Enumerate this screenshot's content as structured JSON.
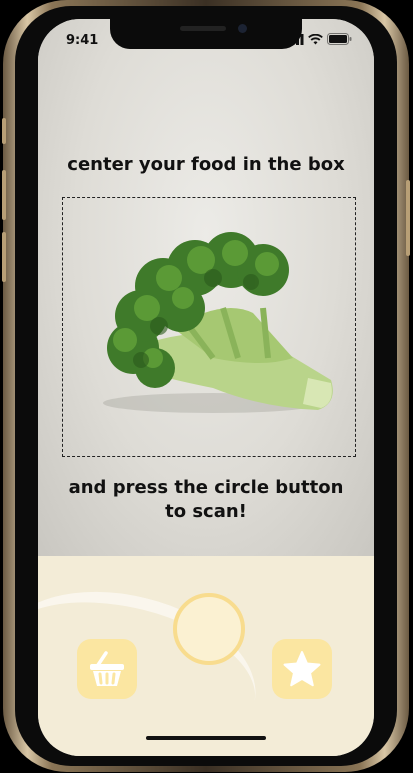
{
  "status_bar": {
    "time": "9:41"
  },
  "instructions": {
    "top": "center your food in the box",
    "bottom_line1": "and press the circle button",
    "bottom_line2": "to scan!"
  },
  "icons": {
    "basket": "basket-icon",
    "star": "star-icon",
    "broccoli": "broccoli-image"
  },
  "colors": {
    "panel": "#f3ecd7",
    "button_fill": "#fbf1d2",
    "button_ring": "#f8dc8e",
    "icon_tile": "#fbe6a1"
  }
}
